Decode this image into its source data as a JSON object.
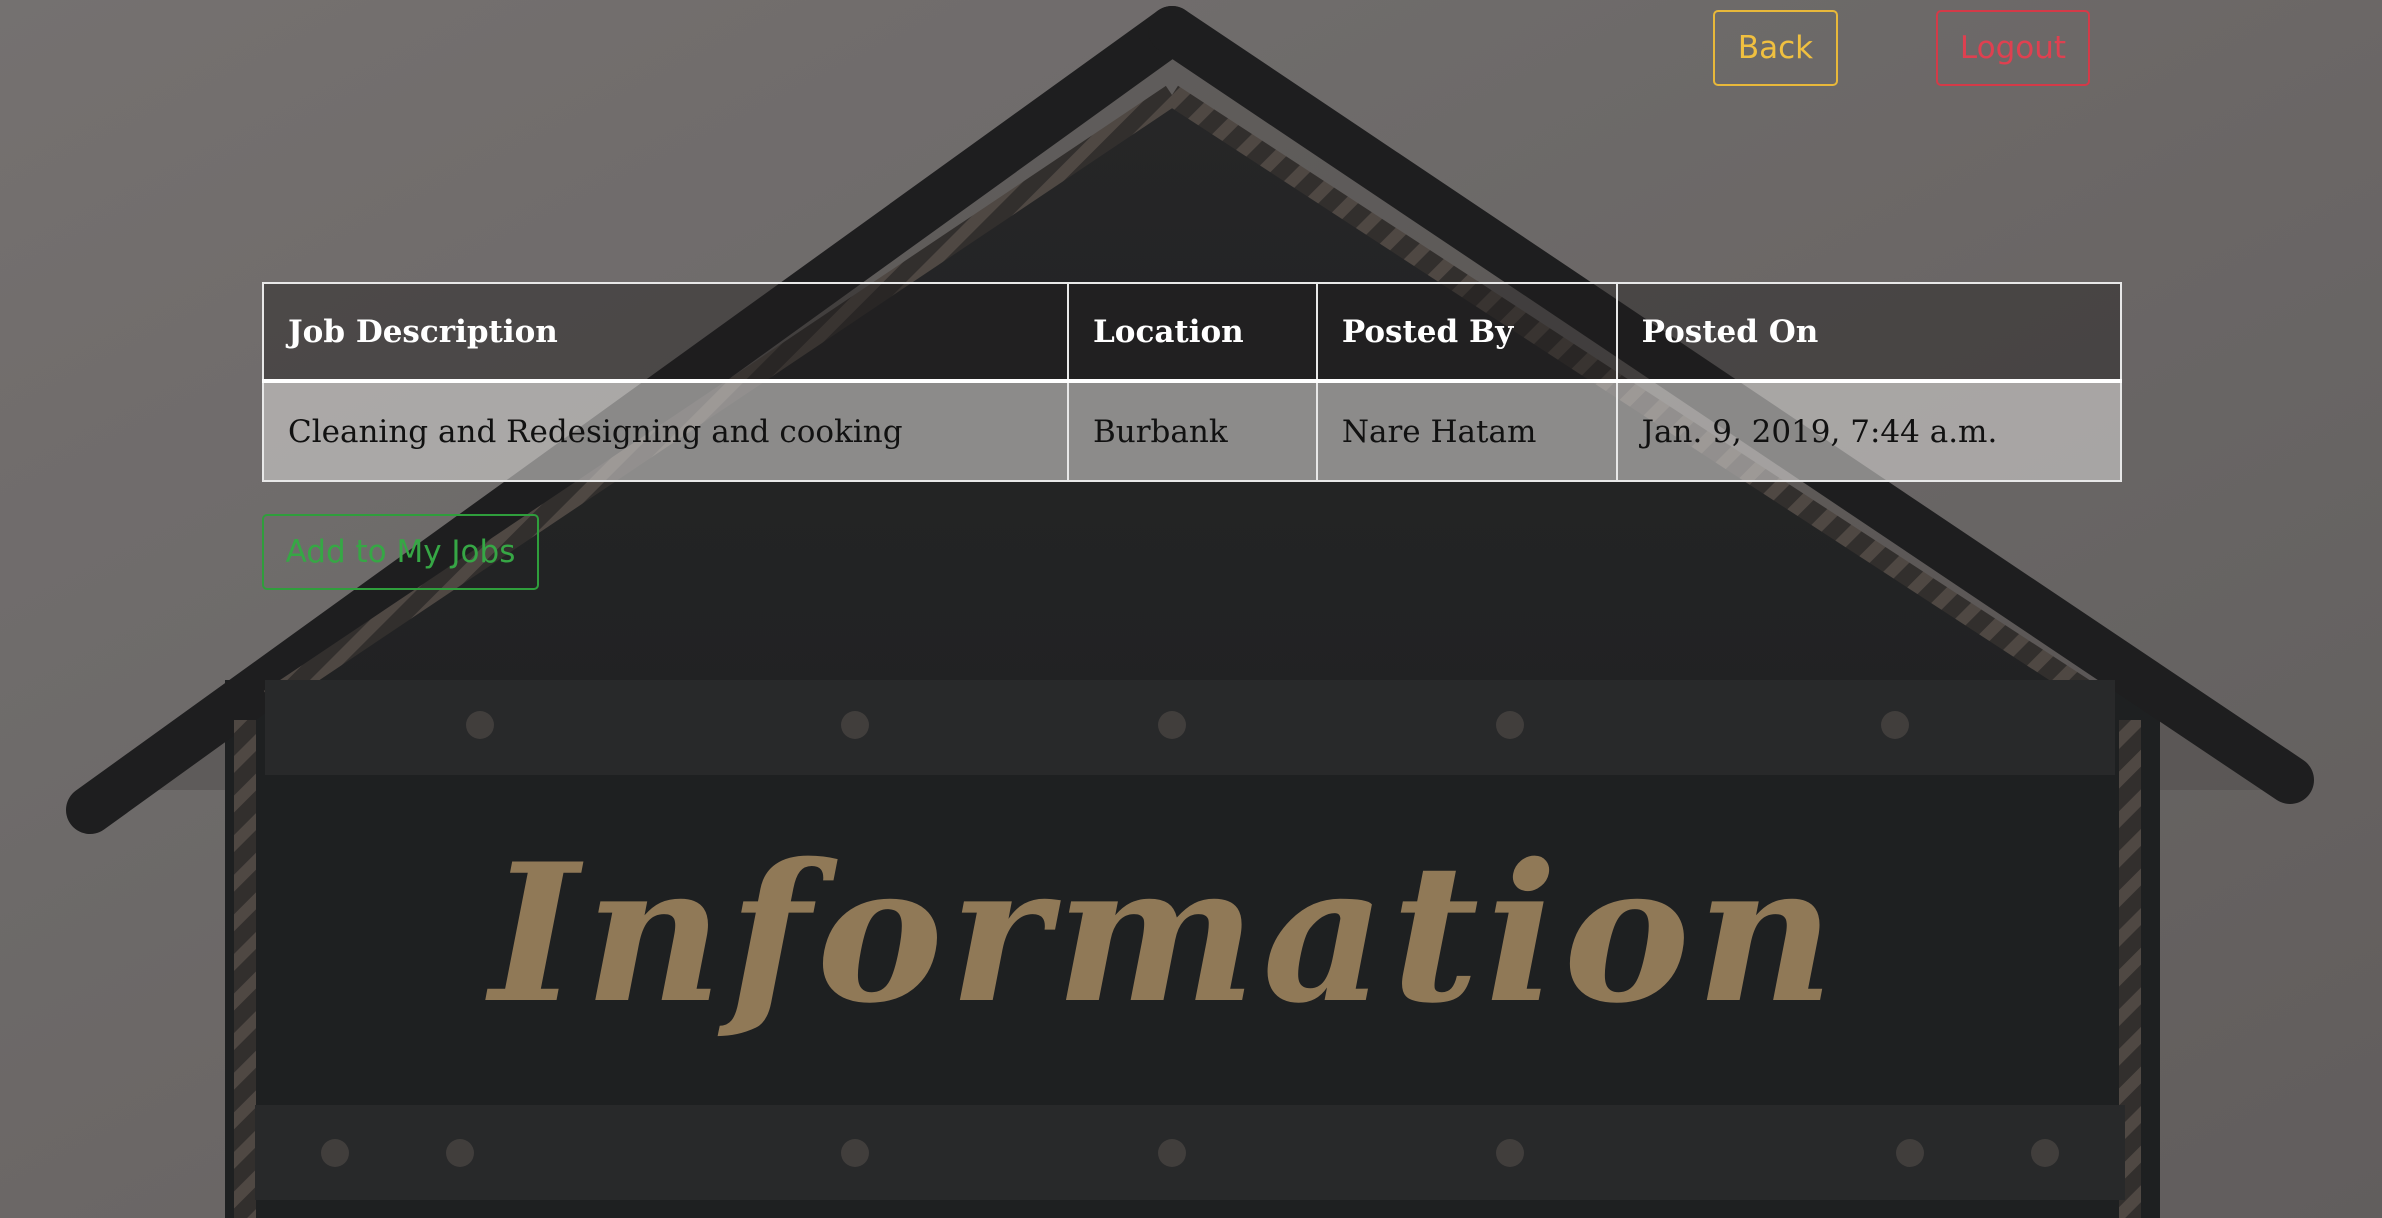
{
  "nav": {
    "back_label": "Back",
    "logout_label": "Logout"
  },
  "jobs_table": {
    "headers": [
      "Job Description",
      "Location",
      "Posted By",
      "Posted On"
    ],
    "rows": [
      [
        "Cleaning and Redesigning and cooking",
        "Burbank",
        "Nare Hatam",
        "Jan. 9, 2019, 7:44 a.m."
      ]
    ]
  },
  "actions": {
    "add_label": "Add to My Jobs"
  },
  "background": {
    "sign_text": "Information"
  },
  "colors": {
    "back": "#f0c040",
    "logout": "#df4050",
    "add": "#36a745"
  }
}
